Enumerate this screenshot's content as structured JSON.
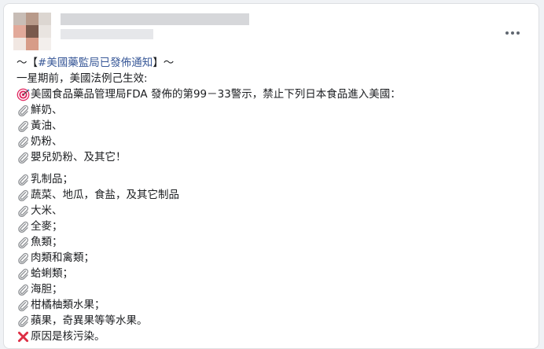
{
  "post": {
    "header": {
      "menu_icon": "more-horizontal-icon"
    },
    "lines_top": [
      {
        "type": "title",
        "prefix": "～【",
        "hashtag": "#美國藥監局已發佈通知",
        "suffix": "】～"
      },
      {
        "type": "plain",
        "text": "一星期前，美國法例己生效:"
      },
      {
        "type": "icon",
        "icon": "target-icon",
        "text": "美國食品藥品管理局FDA 發佈的第99－33警示，禁止下列日本食品進入美國："
      },
      {
        "type": "icon",
        "icon": "paperclip-icon",
        "text": "鮮奶、"
      },
      {
        "type": "icon",
        "icon": "paperclip-icon",
        "text": "黃油、"
      },
      {
        "type": "icon",
        "icon": "paperclip-icon",
        "text": "奶粉、"
      },
      {
        "type": "icon",
        "icon": "paperclip-icon",
        "text": "嬰兒奶粉、及其它！"
      }
    ],
    "lines_bottom": [
      {
        "type": "icon",
        "icon": "paperclip-icon",
        "text": "乳制品；"
      },
      {
        "type": "icon",
        "icon": "paperclip-icon",
        "text": "蔬菜、地瓜，食盐，及其它制品"
      },
      {
        "type": "icon",
        "icon": "paperclip-icon",
        "text": "大米、"
      },
      {
        "type": "icon",
        "icon": "paperclip-icon",
        "text": "全麥；"
      },
      {
        "type": "icon",
        "icon": "paperclip-icon",
        "text": "魚類；"
      },
      {
        "type": "icon",
        "icon": "paperclip-icon",
        "text": "肉類和禽類；"
      },
      {
        "type": "icon",
        "icon": "paperclip-icon",
        "text": "蛤蜊類；"
      },
      {
        "type": "icon",
        "icon": "paperclip-icon",
        "text": "海胆；"
      },
      {
        "type": "icon",
        "icon": "paperclip-icon",
        "text": "柑橘柚類水果；"
      },
      {
        "type": "icon",
        "icon": "paperclip-icon",
        "text": "蘋果，奇異果等等水果。"
      },
      {
        "type": "icon",
        "icon": "cross-mark-icon",
        "text": "原因是核污染。"
      }
    ]
  },
  "colors": {
    "hashtag": "#385898",
    "text": "#1c1e21",
    "target_red": "#e0245e",
    "cross_red": "#dd2e44",
    "clip_gray": "#8a8d91"
  }
}
